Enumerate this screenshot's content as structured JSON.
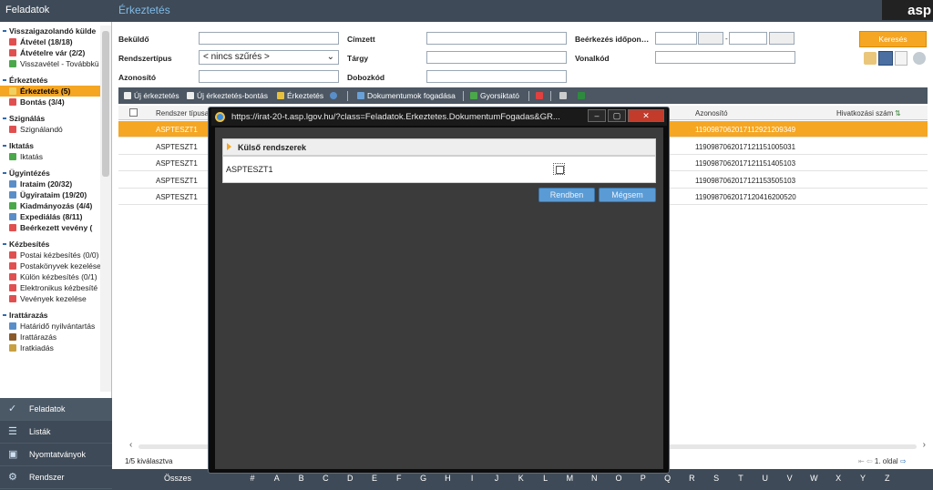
{
  "sidebar": {
    "header": "Feladatok",
    "sections": [
      {
        "title": "Visszaigazolandó külde",
        "items": [
          {
            "label": "Átvétel (18/18)",
            "bold": true,
            "color": "#e05050"
          },
          {
            "label": "Átvételre vár (2/2)",
            "bold": true,
            "color": "#e05050"
          },
          {
            "label": "Visszavétel - Továbbkü",
            "bold": false,
            "color": "#4aa84a"
          }
        ]
      },
      {
        "title": "Érkeztetés",
        "items": [
          {
            "label": "Érkeztetés (5)",
            "bold": true,
            "color": "#f0d060",
            "selected": true
          },
          {
            "label": "Bontás (3/4)",
            "bold": true,
            "color": "#e05050"
          }
        ]
      },
      {
        "title": "Szignálás",
        "items": [
          {
            "label": "Szignálandó",
            "bold": false,
            "color": "#e05050"
          }
        ]
      },
      {
        "title": "Iktatás",
        "items": [
          {
            "label": "Iktatás",
            "bold": false,
            "color": "#4aa84a"
          }
        ]
      },
      {
        "title": "Ügyintézés",
        "items": [
          {
            "label": "Irataim (20/32)",
            "bold": true,
            "color": "#5a8ec8"
          },
          {
            "label": "Ügyirataim (19/20)",
            "bold": true,
            "color": "#5a8ec8"
          },
          {
            "label": "Kiadmányozás (4/4)",
            "bold": true,
            "color": "#4aa84a"
          },
          {
            "label": "Expediálás (8/11)",
            "bold": true,
            "color": "#5a8ec8"
          },
          {
            "label": "Beérkezett vevény (",
            "bold": true,
            "color": "#e05050"
          }
        ]
      },
      {
        "title": "Kézbesítés",
        "items": [
          {
            "label": "Postai kézbesítés (0/0)",
            "bold": false,
            "color": "#e05050"
          },
          {
            "label": "Postakönyvek kezelése",
            "bold": false,
            "color": "#e05050"
          },
          {
            "label": "Külön kézbesítés (0/1)",
            "bold": false,
            "color": "#e05050"
          },
          {
            "label": "Elektronikus kézbesíté",
            "bold": false,
            "color": "#e05050"
          },
          {
            "label": "Vevények kezelése",
            "bold": false,
            "color": "#e05050"
          }
        ]
      },
      {
        "title": "Irattárazás",
        "items": [
          {
            "label": "Határidő nyilvántartás",
            "bold": false,
            "color": "#5a8ec8"
          },
          {
            "label": "Irattárazás",
            "bold": false,
            "color": "#8a5a2a"
          },
          {
            "label": "Iratkiadás",
            "bold": false,
            "color": "#c8a040"
          }
        ]
      }
    ],
    "bottom_nav": [
      {
        "label": "Feladatok",
        "icon": "check-icon",
        "active": true
      },
      {
        "label": "Listák",
        "icon": "list-icon",
        "active": false
      },
      {
        "label": "Nyomtatványok",
        "icon": "form-icon",
        "active": false
      },
      {
        "label": "Rendszer",
        "icon": "system-icon",
        "active": false
      }
    ]
  },
  "header": {
    "title": "Érkeztetés",
    "logo": "asp"
  },
  "filters": {
    "bekuldo": "Beküldő",
    "rendszertipus": "Rendszertípus",
    "rendszertipus_value": "< nincs szűrés >",
    "azonosito": "Azonosító",
    "cimzett": "Címzett",
    "targy": "Tárgy",
    "dobozkod": "Dobozkód",
    "beerkezes": "Beérkezés időpon…",
    "vonalkod": "Vonalkód",
    "search_button": "Keresés"
  },
  "toolbar": {
    "new": "Új érkeztetés",
    "new_open": "Új érkeztetés-bontás",
    "erk": "Érkeztetés",
    "doc": "Dokumentumok fogadása",
    "quick": "Gyorsiktató"
  },
  "grid": {
    "col_type": "Rendszer típusa",
    "col_id": "Azonosító",
    "col_ref": "Hivatkozási szám",
    "rows": [
      {
        "type": "ASPTESZT1",
        "id": "1190987062017112921209349"
      },
      {
        "type": "ASPTESZT1",
        "id": "1190987062017121151005031"
      },
      {
        "type": "ASPTESZT1",
        "id": "1190987062017121151405103"
      },
      {
        "type": "ASPTESZT1",
        "id": "1190987062017121153505103"
      },
      {
        "type": "ASPTESZT1",
        "id": "1190987062017120416200520"
      }
    ],
    "selected_status": "1/5 kiválasztva",
    "page": "1. oldal"
  },
  "alpha": {
    "all": "Összes",
    "letters": [
      "#",
      "A",
      "B",
      "C",
      "D",
      "E",
      "F",
      "G",
      "H",
      "I",
      "J",
      "K",
      "L",
      "M",
      "N",
      "O",
      "P",
      "Q",
      "R",
      "S",
      "T",
      "U",
      "V",
      "W",
      "X",
      "Y",
      "Z"
    ]
  },
  "modal": {
    "url": "https://irat-20-t.asp.lgov.hu/?class=Feladatok.Erkeztetes.DokumentumFogadas&GR...",
    "section": "Külső rendszerek",
    "row": "ASPTESZT1",
    "ok": "Rendben",
    "cancel": "Mégsem"
  }
}
